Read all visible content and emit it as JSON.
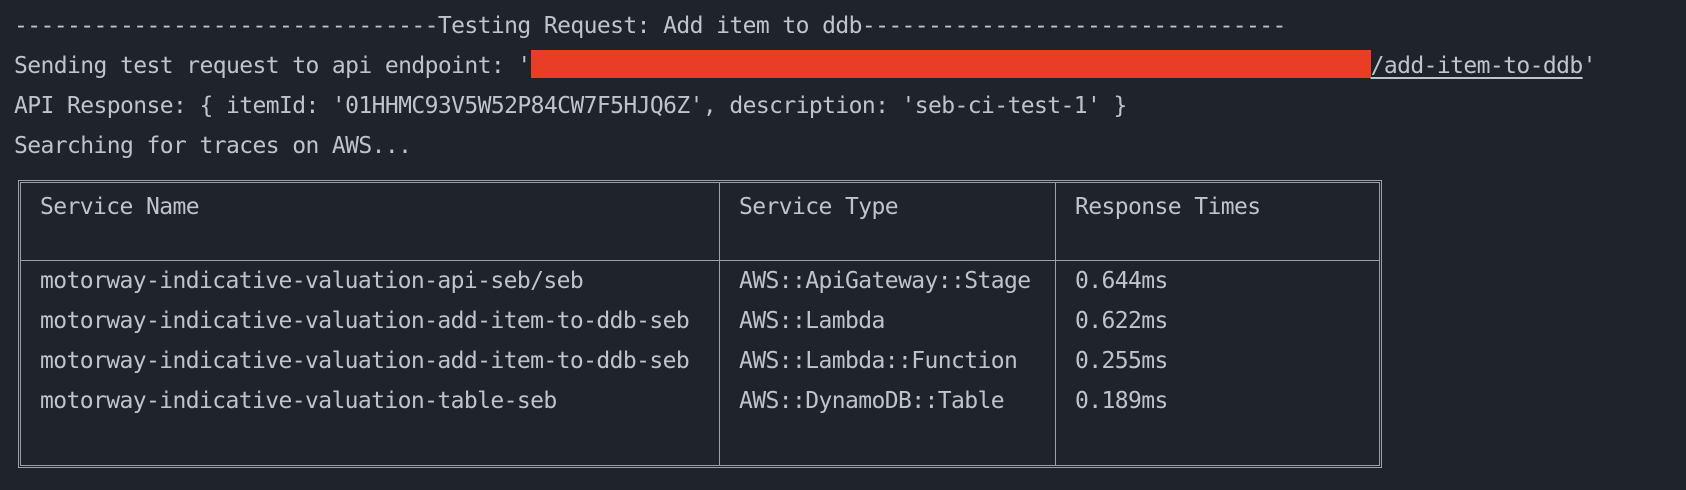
{
  "terminal": {
    "header_line": "--------------------------------Testing Request: Add item to ddb--------------------------------",
    "sending_prefix": "Sending test request to api endpoint: '",
    "endpoint_tail": "/add-item-to-ddb",
    "sending_suffix": "'",
    "api_response": "API Response: { itemId: '01HHMC93V5W52P84CW7F5HJQ6Z', description: 'seb-ci-test-1' }",
    "searching": "Searching for traces on AWS..."
  },
  "table": {
    "headers": [
      "Service Name",
      "Service Type",
      "Response Times"
    ],
    "rows": [
      [
        "motorway-indicative-valuation-api-seb/seb",
        "AWS::ApiGateway::Stage",
        "0.644ms"
      ],
      [
        "motorway-indicative-valuation-add-item-to-ddb-seb",
        "AWS::Lambda",
        "0.622ms"
      ],
      [
        "motorway-indicative-valuation-add-item-to-ddb-seb",
        "AWS::Lambda::Function",
        "0.255ms"
      ],
      [
        "motorway-indicative-valuation-table-seb",
        "AWS::DynamoDB::Table",
        "0.189ms"
      ]
    ]
  },
  "colors": {
    "background": "#1f232a",
    "text": "#bfc4cc",
    "redaction": "#ea3d26",
    "border": "#9ba1ab"
  }
}
